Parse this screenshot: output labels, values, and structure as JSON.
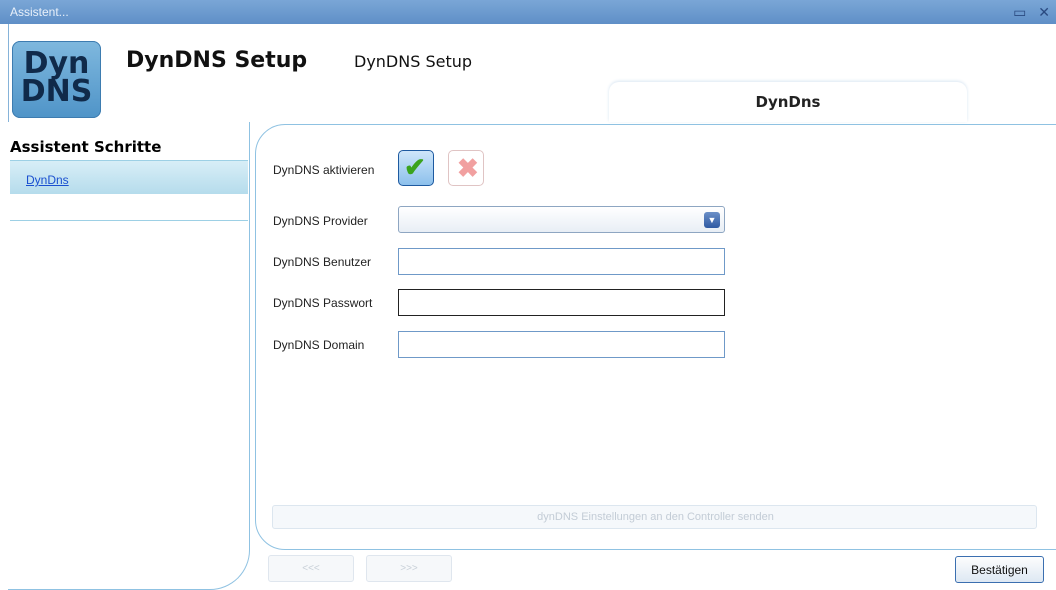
{
  "window": {
    "title": "Assistent...",
    "controls": "▭ ✕"
  },
  "logo": {
    "line1": "Dyn",
    "line2": "DNS"
  },
  "header": {
    "title": "DynDNS Setup",
    "subtitle": "DynDNS Setup"
  },
  "tab": {
    "label": "DynDns"
  },
  "steps": {
    "heading": "Assistent Schritte",
    "items": [
      {
        "label": "DynDns"
      }
    ]
  },
  "form": {
    "activate_label": "DynDNS aktivieren",
    "provider_label": "DynDNS Provider",
    "provider_value": "",
    "user_label": "DynDNS Benutzer",
    "user_value": "",
    "password_label": "DynDNS Passwort",
    "password_value": "",
    "domain_label": "DynDNS Domain",
    "domain_value": ""
  },
  "actions": {
    "send_label": "dynDNS Einstellungen an den Controller senden",
    "prev_label": "<<<",
    "next_label": ">>>",
    "confirm_label": "Bestätigen"
  }
}
